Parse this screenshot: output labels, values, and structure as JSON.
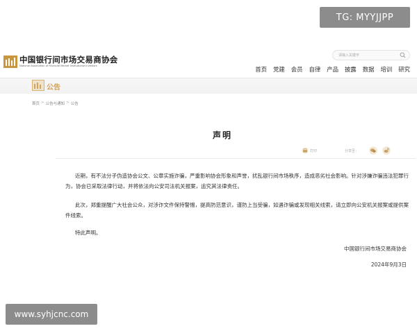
{
  "watermarks": {
    "top_right": "TG: MYYJJPP",
    "bottom_left": "www.syhjcnc.com"
  },
  "header": {
    "org_name": "中国银行间市场交易商协会",
    "org_name_en": "National Association of Financial Market Institutional Investors",
    "search_placeholder": "请输入关键字",
    "nav": [
      "首页",
      "党建",
      "会员",
      "自律",
      "产品",
      "披露",
      "数据",
      "培训",
      "研究"
    ]
  },
  "banner": {
    "title": "公告"
  },
  "breadcrumb": [
    "首页",
    "公告与通知",
    "公告"
  ],
  "breadcrumb_separator": ">",
  "notice": {
    "title": "声明",
    "print_label": "打印",
    "share_label": "分享至：",
    "paragraphs": [
      "近期，有不法分子伪造协会公文、公章实施诈骗，严重影响协会形象和声誉，扰乱银行间市场秩序，造成恶劣社会影响。针对涉嫌诈骗违法犯罪行为，协会已采取法律行动，并将依法向公安司法机关报案，追究其法律责任。",
      "此次，郑重提醒广大社会公众，对涉诈文件保持警惕，提高防范意识，谨防上当受骗，如遇诈骗或发现相关线索，请立即向公安机关报案或提供案件线索。",
      "特此声明。"
    ],
    "signature": "中国银行间市场交易商协会",
    "date": "2024年9月3日"
  },
  "colors": {
    "accent_gold": "#d2a35a",
    "text": "#333333",
    "watermark_bg": "#8c8c8c"
  },
  "icons": {
    "logo": "association-logo-icon",
    "search": "search-icon",
    "banner": "announcement-icon",
    "print": "print-icon",
    "share": [
      "wechat-icon",
      "weibo-icon"
    ]
  }
}
